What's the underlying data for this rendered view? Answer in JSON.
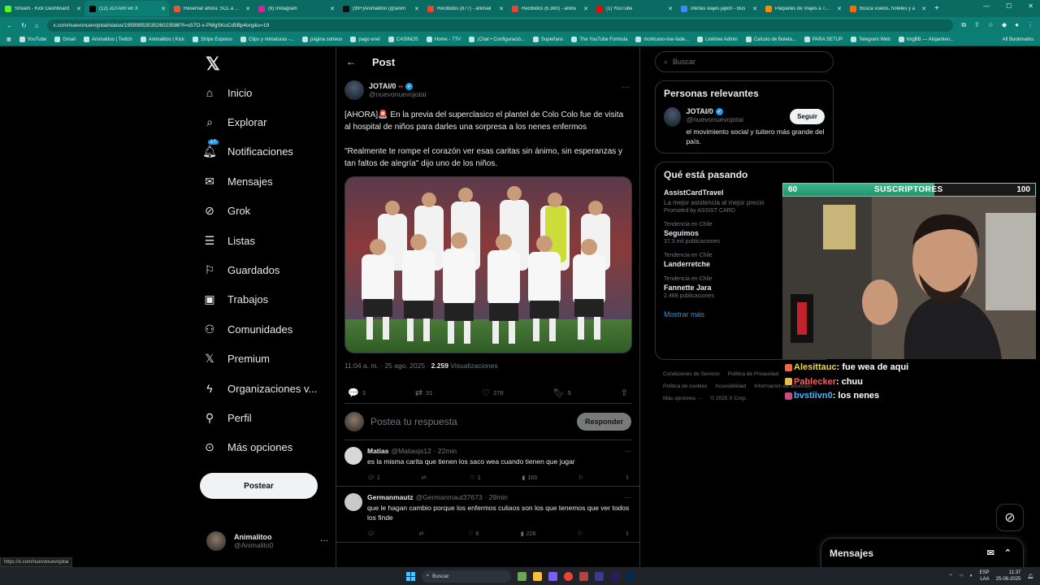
{
  "browser": {
    "tabs": [
      {
        "label": "Stream - Kick Dashboard",
        "color": "#53fc18",
        "active": false
      },
      {
        "label": "(12) JOTAI/0 en X",
        "color": "#000000",
        "active": true
      },
      {
        "label": "Reservar ahora: SCL a TYO",
        "color": "#e8563a",
        "active": false
      },
      {
        "label": "(9) Instagram",
        "color": "#d6249f",
        "active": false
      },
      {
        "label": "(99+)Animalitoo (@anim",
        "color": "#111111",
        "active": false
      },
      {
        "label": "Recibidos (877) - animali",
        "color": "#ea4335",
        "active": false
      },
      {
        "label": "Recibidos (6.380) - anibu",
        "color": "#ea4335",
        "active": false
      },
      {
        "label": "(1) YouTube",
        "color": "#ff0000",
        "active": false
      },
      {
        "label": "ofertas viajes japon - Bus",
        "color": "#4285f4",
        "active": false
      },
      {
        "label": "Paquetes de Viajes a Toky",
        "color": "#ff8a00",
        "active": false
      },
      {
        "label": "Busca vuelos, hoteles y a",
        "color": "#ff6a00",
        "active": false
      }
    ],
    "url": "x.com/nuevonuevojotai/status/1959995303526023586?t=s57O-x-PMgSKoCd5Bp4org&s=19",
    "bookmarks": [
      "YouTube",
      "Gmail",
      "Animalitoo | Twitch",
      "Animalitoo | Kick",
      "Stripe Express",
      "Clips y miniaturas -...",
      "página sorteos",
      "pago enel",
      "CASINOS",
      "Home - 7TV",
      "¡Chat • Configuració...",
      "Superfans",
      "The YouTube Formula",
      "mohicano-low-fade...",
      "Linktree Admin",
      "Calculo de Boleta...",
      "PARA SETUP",
      "Telegram Web",
      "ImgBB — Alojamien..."
    ],
    "all_bookmarks": "All Bookmarks",
    "status_url": "https://x.com/nuevonuevojotai"
  },
  "nav": {
    "items": [
      {
        "label": "Inicio",
        "icon": "home-icon"
      },
      {
        "label": "Explorar",
        "icon": "search-icon"
      },
      {
        "label": "Notificaciones",
        "icon": "bell-icon"
      },
      {
        "label": "Mensajes",
        "icon": "mail-icon"
      },
      {
        "label": "Grok",
        "icon": "grok-icon"
      },
      {
        "label": "Listas",
        "icon": "list-icon"
      },
      {
        "label": "Guardados",
        "icon": "bookmark-icon"
      },
      {
        "label": "Trabajos",
        "icon": "briefcase-icon"
      },
      {
        "label": "Comunidades",
        "icon": "people-icon"
      },
      {
        "label": "Premium",
        "icon": "x-logo-icon"
      },
      {
        "label": "Organizaciones v...",
        "icon": "lightning-icon"
      },
      {
        "label": "Perfil",
        "icon": "person-icon"
      },
      {
        "label": "Más opciones",
        "icon": "more-circle-icon"
      }
    ],
    "notif_badge": "17",
    "post_button": "Postear",
    "account_name": "Animalitoo",
    "account_handle": "@Animalito0"
  },
  "main": {
    "title": "Post",
    "author_name": "JOTAI/0",
    "author_handle": "@nuevonuevojotai",
    "text": "[AHORA]🚨 En la previa del superclasico el plantel de Colo Colo fue de visita al hospital de niños para darles una sorpresa a los nenes enfermos\n\n\"Realmente te rompe el corazón ver esas caritas sin ánimo, sin esperanzas y tan faltos de alegría\" dijo uno de los niños.",
    "time": "11:04 a. m. · 25 ago. 2025 ·",
    "views": "2.259",
    "views_label": "Visualizaciones",
    "replies": "3",
    "reposts": "31",
    "likes": "278",
    "bookmarks": "5",
    "reply_placeholder": "Postea tu respuesta",
    "reply_button": "Responder",
    "comments": [
      {
        "name": "Matias",
        "handle": "@Matiasjs12",
        "time": "· 22min",
        "text": "es la misma carita que tienen los saco wea cuando tienen que jugar",
        "replies": "1",
        "reposts": "",
        "likes": "1",
        "views": "163",
        "avatar": "#d8d8d8"
      },
      {
        "name": "Germanmautz",
        "handle": "@Germanmaut37673",
        "time": "· 29min",
        "text": "que le hagan cambio porque los enfermos culiaos son los que tenemos que ver todos los finde",
        "replies": "",
        "reposts": "",
        "likes": "6",
        "views": "226",
        "avatar": "#c9c9c9"
      }
    ]
  },
  "right": {
    "search_placeholder": "Buscar",
    "relevant_title": "Personas relevantes",
    "person_name": "JOTAI/0",
    "person_handle": "@nuevonuevojotai",
    "follow": "Seguir",
    "person_bio": "el movimiento social y tuitero más grande del país.",
    "trending_title": "Qué está pasando",
    "promo_name": "AssistCardTravel",
    "promo_desc": "La mejor asistencia al mejor precio",
    "promo_by": "Promoted by ASSIST CARD",
    "trends": [
      {
        "meta": "Tendencia en Chile",
        "name": "Seguimos",
        "count": "37,3 mil publicaciones"
      },
      {
        "meta": "Tendencia en Chile",
        "name": "Landerretche",
        "count": ""
      },
      {
        "meta": "Tendencia en Chile",
        "name": "Fannette Jara",
        "count": "2.468 publicaciones"
      }
    ],
    "show_more": "Mostrar más",
    "footer": [
      "Condiciones de Servicio",
      "Política de Privacidad",
      "Política de cookies",
      "Accesibilidad",
      "Información de anuncios",
      "Más opciones ···",
      "© 2025 X Corp."
    ]
  },
  "overlay": {
    "sub_left": "60",
    "sub_label": "SUSCRIPTORES",
    "sub_right": "100",
    "sub_progress": 0.6,
    "chat": [
      {
        "user": "Alesittauc",
        "msg": "fue wea de aqui",
        "cls": "u1"
      },
      {
        "user": "Pablecker",
        "msg": "chuu",
        "cls": "u2"
      },
      {
        "user": "bvstiivn0",
        "msg": "los nenes",
        "cls": "u3"
      }
    ]
  },
  "messages_drawer": "Mensajes",
  "taskbar": {
    "search": "Buscar",
    "lang": "ESP",
    "lang2": "LAA",
    "time": "11:37",
    "date": "25-08-2025"
  }
}
